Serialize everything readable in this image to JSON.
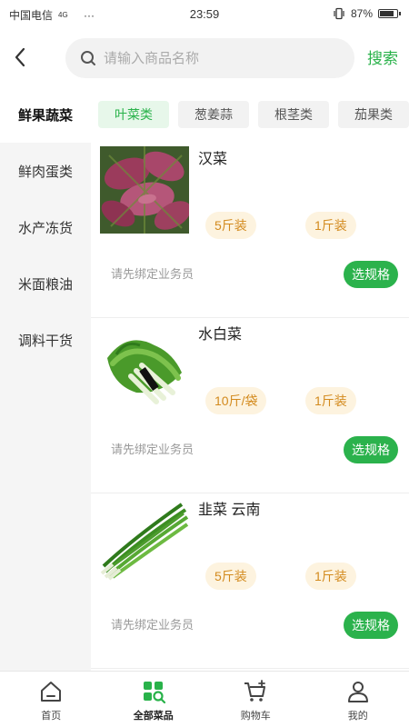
{
  "status_bar": {
    "carrier": "中国电信",
    "network": "4G",
    "dots": "···",
    "time": "23:59",
    "battery": "87%",
    "battery_level": 0.87
  },
  "header": {
    "search_placeholder": "请输入商品名称",
    "search_button": "搜索"
  },
  "sidebar": {
    "items": [
      {
        "label": "鲜果蔬菜",
        "active": true
      },
      {
        "label": "鲜肉蛋类",
        "active": false
      },
      {
        "label": "水产冻货",
        "active": false
      },
      {
        "label": "米面粮油",
        "active": false
      },
      {
        "label": "调料干货",
        "active": false
      }
    ]
  },
  "tabs": [
    {
      "label": "叶菜类",
      "active": true
    },
    {
      "label": "葱姜蒜",
      "active": false
    },
    {
      "label": "根茎类",
      "active": false
    },
    {
      "label": "茄果类",
      "active": false
    }
  ],
  "products": [
    {
      "name": "汉菜",
      "specs": [
        "5斤装",
        "1斤装"
      ],
      "hint": "请先绑定业务员",
      "action": "选规格"
    },
    {
      "name": "水白菜",
      "specs": [
        "10斤/袋",
        "1斤装"
      ],
      "hint": "请先绑定业务员",
      "action": "选规格"
    },
    {
      "name": "韭菜 云南",
      "specs": [
        "5斤装",
        "1斤装"
      ],
      "hint": "请先绑定业务员",
      "action": "选规格"
    }
  ],
  "bottom_nav": [
    {
      "label": "首页",
      "icon": "home-icon",
      "active": false
    },
    {
      "label": "全部菜品",
      "icon": "category-search-icon",
      "active": true
    },
    {
      "label": "购物车",
      "icon": "cart-icon",
      "active": false
    },
    {
      "label": "我的",
      "icon": "user-icon",
      "active": false
    }
  ],
  "colors": {
    "accent": "#29b24a",
    "spec_bg": "#fdf3df",
    "spec_text": "#d38a1d",
    "sidebar_bg": "#f5f5f5"
  }
}
